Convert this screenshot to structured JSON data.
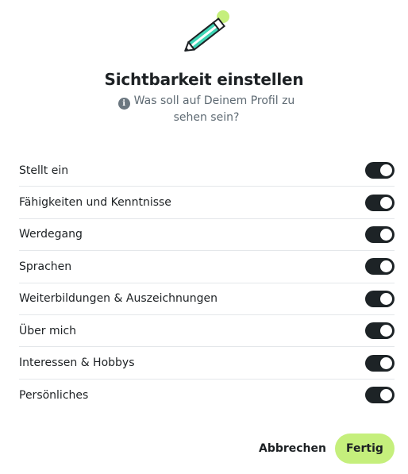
{
  "dialog": {
    "title": "Sichtbarkeit einstellen",
    "subtitle": "Was soll auf Deinem Profil zu sehen sein?",
    "info_icon": "info-icon",
    "header_icon": "pencil-icon"
  },
  "sections": [
    {
      "label": "Stellt ein",
      "enabled": true
    },
    {
      "label": "Fähigkeiten und Kenntnisse",
      "enabled": true
    },
    {
      "label": "Werdegang",
      "enabled": true
    },
    {
      "label": "Sprachen",
      "enabled": true
    },
    {
      "label": "Weiterbildungen & Auszeichnungen",
      "enabled": true
    },
    {
      "label": "Über mich",
      "enabled": true
    },
    {
      "label": "Interessen & Hobbys",
      "enabled": true
    },
    {
      "label": "Persönliches",
      "enabled": true
    }
  ],
  "footer": {
    "cancel_label": "Abbrechen",
    "done_label": "Fertig"
  },
  "colors": {
    "accent": "#c5ef7c",
    "pencil_teal": "#3ed5b5",
    "toggle_on": "#1d2326"
  }
}
